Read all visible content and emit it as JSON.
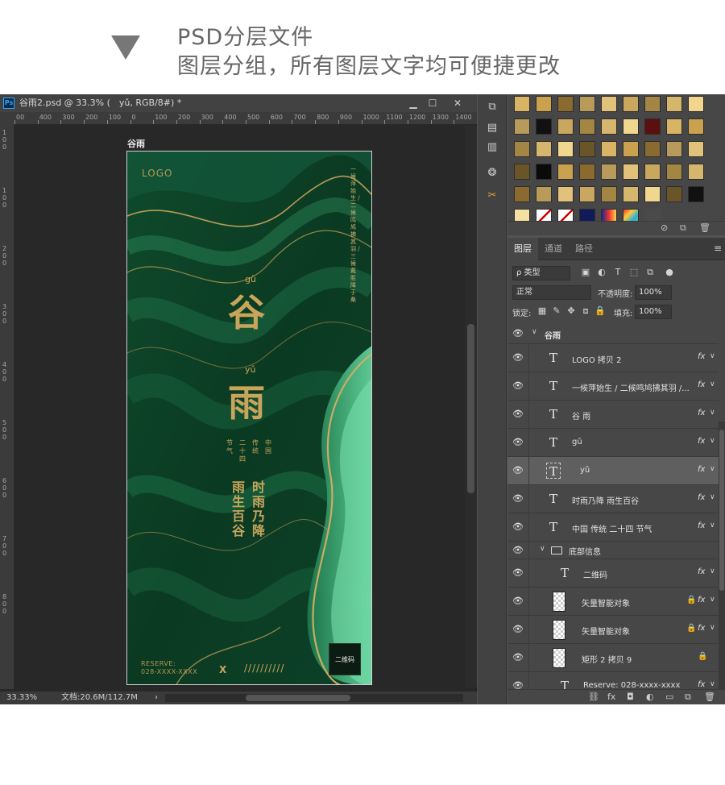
{
  "caption": {
    "line1": "PSD分层文件",
    "line2": "图层分组，所有图层文字均可便捷更改"
  },
  "document": {
    "app_badge": "Ps",
    "title": "谷雨2.psd @ 33.3% (　yǔ, RGB/8#) *",
    "minimize": "▁",
    "restore": "☐",
    "close": "✕",
    "ruler_ticks": [
      "00",
      "400",
      "300",
      "200",
      "100",
      "0",
      "100",
      "200",
      "300",
      "400",
      "500",
      "600",
      "700",
      "800",
      "900",
      "1000",
      "1100",
      "1200",
      "1300",
      "1400"
    ],
    "ruler_v_labels": [
      "1",
      "0",
      "0",
      "1",
      "0",
      "0",
      "2",
      "0",
      "0",
      "3",
      "0",
      "0",
      "4",
      "0",
      "0",
      "5",
      "0",
      "0",
      "6",
      "0",
      "0",
      "7",
      "0",
      "0",
      "8",
      "0",
      "0"
    ],
    "artboard_label": "谷雨",
    "zoom": "33.33%",
    "doc_size": "文档:20.6M/112.7M",
    "status_arrow": "›"
  },
  "poster": {
    "logo": "LOGO",
    "vertical_text": "一候萍始生 / 二候鸣鸠拂其羽 / 三候戴胜降于桑",
    "gu_pinyin": "gǔ",
    "gu": "谷",
    "yu_pinyin": "yǔ",
    "yu": "雨",
    "trad_cols": [
      "中国",
      "传统",
      "二十四",
      "节气"
    ],
    "poem_cols": [
      "时雨乃降",
      "雨生百谷"
    ],
    "reserve_line1": "RESERVE:",
    "reserve_line2": "028-XXXX-XXXX",
    "x_mark": "X",
    "slashes": "//////////",
    "qr_label": "二维码",
    "colors": {
      "dark": "#0e3a24",
      "mid": "#1a6b43",
      "light": "#5fd49a",
      "gold": "#c9a55c"
    }
  },
  "tools": {
    "t1": "⧉",
    "t2": "▤",
    "t3": "▥",
    "t4": "❂",
    "t5": "✂"
  },
  "swatch_footer": {
    "no_icon": "⊘",
    "new_icon": "⧉",
    "delete_icon": "🗑"
  },
  "layers_panel": {
    "tabs": [
      "图层",
      "通道",
      "路径"
    ],
    "menu_icon": "≡",
    "filter_kind": "ρ 类型",
    "blend_mode": "正常",
    "opacity_label": "不透明度:",
    "opacity_value": "100%",
    "lock_label": "锁定:",
    "fill_label": "填充:",
    "fill_value": "100%",
    "group_name": "谷雨",
    "layers": [
      {
        "name": "LOGO 拷贝 2",
        "type": "text",
        "fx": "fx",
        "lock": ""
      },
      {
        "name": "一候萍始生  / 二候鸣鸠拂其羽  /...",
        "type": "text",
        "fx": "fx",
        "lock": ""
      },
      {
        "name": "谷 雨",
        "type": "text",
        "fx": "fx",
        "lock": ""
      },
      {
        "name": "gǔ",
        "type": "text",
        "fx": "fx",
        "lock": ""
      },
      {
        "name": "yǔ",
        "type": "text",
        "fx": "fx",
        "lock": ""
      },
      {
        "name": "时雨乃降 雨生百谷",
        "type": "text",
        "fx": "fx",
        "lock": ""
      },
      {
        "name": "中国 传统  二十四  节气",
        "type": "text",
        "fx": "fx",
        "lock": ""
      },
      {
        "name": "底部信息",
        "type": "folder",
        "fx": "",
        "lock": ""
      },
      {
        "name": "二维码",
        "type": "text",
        "fx": "fx",
        "lock": ""
      },
      {
        "name": "矢量智能对象",
        "type": "smart",
        "fx": "fx",
        "lock": "🔒"
      },
      {
        "name": "矢量智能对象",
        "type": "smart",
        "fx": "fx",
        "lock": "🔒"
      },
      {
        "name": "矩形 2 拷贝 9",
        "type": "smart",
        "fx": "",
        "lock": "🔒"
      },
      {
        "name": "Reserve: 028-xxxx-xxxx",
        "type": "text",
        "fx": "fx",
        "lock": ""
      }
    ],
    "footer_icons": [
      "⛓",
      "fx",
      "◘",
      "◐",
      "▭",
      "⧉",
      "🗑"
    ]
  }
}
